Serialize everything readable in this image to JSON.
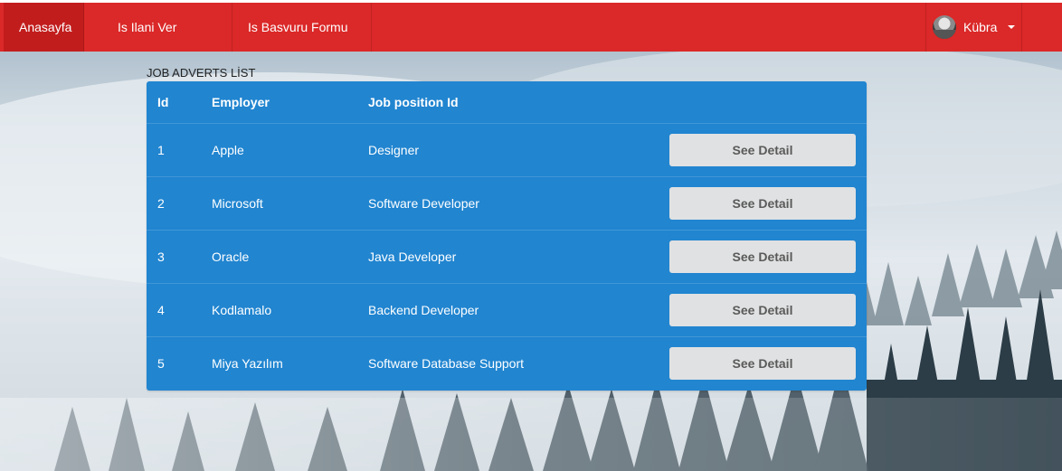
{
  "navbar": {
    "items": [
      {
        "label": "Anasayfa"
      },
      {
        "label": "Is Ilani Ver"
      },
      {
        "label": "Is Basvuru Formu"
      }
    ],
    "user": {
      "name": "Kübra"
    },
    "color": "#db2828"
  },
  "list": {
    "title": "JOB ADVERTS LİST",
    "headers": [
      "Id",
      "Employer",
      "Job position Id"
    ],
    "rows": [
      {
        "id": "1",
        "employer": "Apple",
        "position": "Designer",
        "action": "See Detail"
      },
      {
        "id": "2",
        "employer": "Microsoft",
        "position": "Software Developer",
        "action": "See Detail"
      },
      {
        "id": "3",
        "employer": "Oracle",
        "position": "Java Developer",
        "action": "See Detail"
      },
      {
        "id": "4",
        "employer": "Kodlamalo",
        "position": "Backend Developer",
        "action": "See Detail"
      },
      {
        "id": "5",
        "employer": "Miya Yazılım",
        "position": "Software Database Support",
        "action": "See Detail"
      }
    ],
    "color": "#2185d0"
  }
}
